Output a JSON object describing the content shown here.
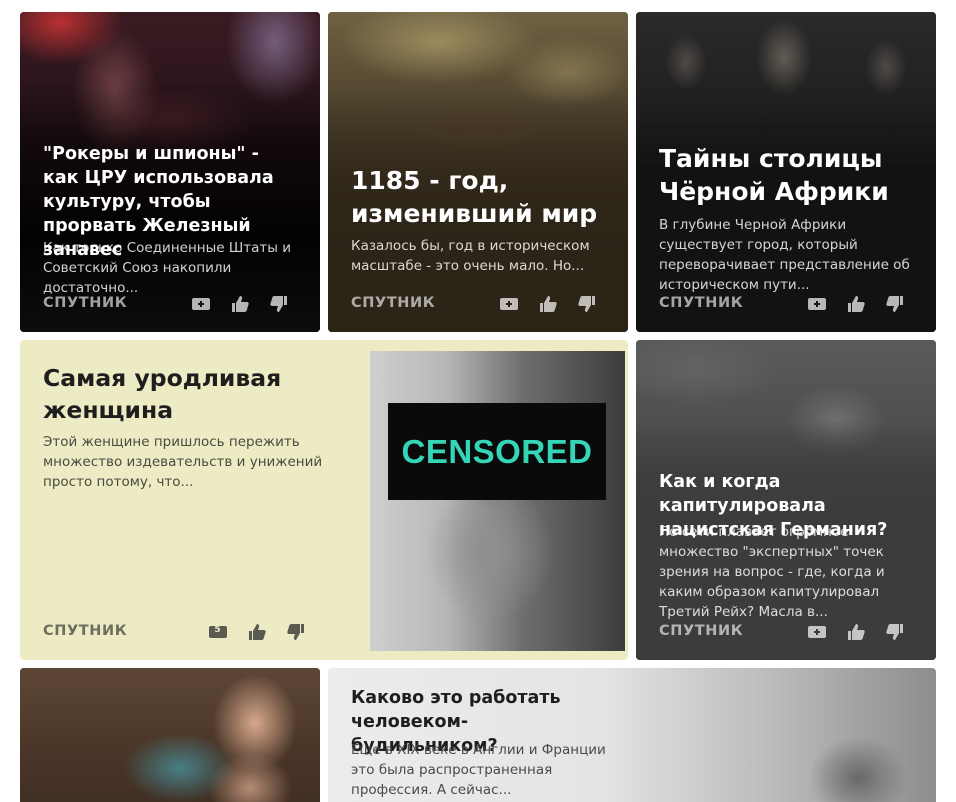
{
  "colors": {
    "card_dark": "#121212",
    "card_olive": "#2c2417",
    "card_cream": "#ecebc4",
    "card_gray": "#3c3c3c",
    "censored_text": "#35d6b8"
  },
  "cards": [
    {
      "title": "\"Рокеры и шпионы\" - как ЦРУ использовала культуру, чтобы прорвать Железный занавес",
      "desc": "Как только Соединенные Штаты и Советский Союз накопили достаточно...",
      "source": "СПУТНИК",
      "icons": [
        "add-icon",
        "like-icon",
        "dislike-icon"
      ]
    },
    {
      "title": "1185 - год, изменивший мир",
      "desc": "Казалось бы, год в историческом масштабе - это очень мало. Но...",
      "source": "СПУТНИК",
      "icons": [
        "add-icon",
        "like-icon",
        "dislike-icon"
      ]
    },
    {
      "title": "Тайны столицы Чёрной Африки",
      "desc": "В глубине Черной Африки существует город, который переворачивает представление об историческом пути...",
      "source": "СПУТНИК",
      "icons": [
        "add-icon",
        "like-icon",
        "dislike-icon"
      ]
    },
    {
      "title": "Самая уродливая женщина",
      "desc": "Этой женщине пришлось пережить множество издевательств и унижений просто потому, что...",
      "source": "СПУТНИК",
      "comments": "5",
      "censor_label": "CENSORED",
      "icons": [
        "comments-icon",
        "like-icon",
        "dislike-icon"
      ]
    },
    {
      "title": "Как и когда капитулировала нацистская Германия?",
      "desc": "По сети плавает огромное множество \"экспертных\" точек зрения на вопрос - где, когда и каким образом капитулировал Третий Рейх? Масла в...",
      "source": "СПУТНИК",
      "icons": [
        "add-icon",
        "like-icon",
        "dislike-icon"
      ]
    },
    {
      "title": "",
      "desc": ""
    },
    {
      "title": "Каково это работать человеком-будильником?",
      "desc": "Еще в XIX веке в Англии и Франции это была распространенная профессия. А сейчас..."
    }
  ]
}
